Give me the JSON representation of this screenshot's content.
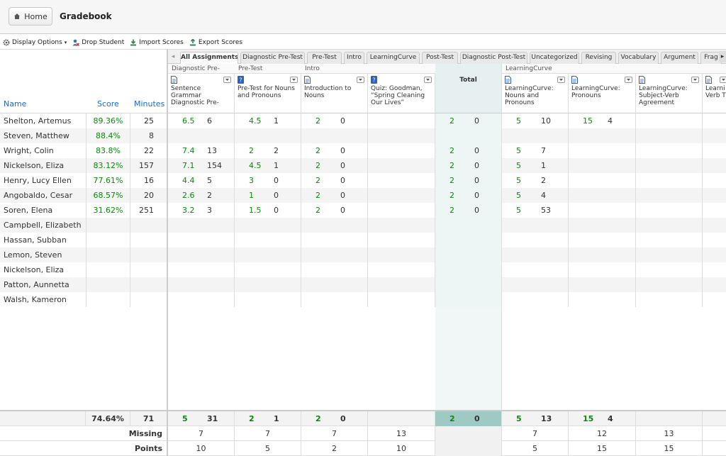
{
  "topbar": {
    "home_label": "Home",
    "title": "Gradebook"
  },
  "toolbar": {
    "display_options": "Display Options",
    "drop_student": "Drop Student",
    "import_scores": "Import Scores",
    "export_scores": "Export Scores"
  },
  "columns": {
    "name": "Name",
    "score": "Score",
    "minutes": "Minutes"
  },
  "tabs": [
    "All Assignments",
    "Diagnostic Pre-Test",
    "Pre-Test",
    "Intro",
    "LearningCurve",
    "Post-Test",
    "Diagnostic Post-Test",
    "Uncategorized",
    "Revising",
    "Vocabulary",
    "Argument",
    "Frag"
  ],
  "groups": [
    "Diagnostic Pre-",
    "Pre-Test",
    "Intro",
    "LearningCurve"
  ],
  "assignments": [
    {
      "title": "Sentence Grammar Diagnostic Pre-",
      "icon": "doc"
    },
    {
      "title": "Pre-Test for Nouns and Pronouns",
      "icon": "quiz"
    },
    {
      "title": "Introduction to Nouns",
      "icon": "doc"
    },
    {
      "title": "Quiz: Goodman, “Spring Cleaning Our Lives”",
      "icon": "quiz"
    },
    {
      "title": "Total",
      "icon": ""
    },
    {
      "title": "LearningCurve: Nouns and Pronouns",
      "icon": "doc"
    },
    {
      "title": "LearningCurve: Pronouns",
      "icon": "doc"
    },
    {
      "title": "LearningCurve: Subject-Verb Agreement",
      "icon": "doc"
    },
    {
      "title": "Learni Verb T",
      "icon": "doc"
    }
  ],
  "students": [
    {
      "name": "Shelton, Artemus",
      "score": "89.36%",
      "minutes": "25",
      "cells": [
        [
          "6.5",
          "6"
        ],
        [
          "4.5",
          "1"
        ],
        [
          "2",
          "0"
        ],
        [
          "",
          ""
        ],
        [
          "2",
          "0"
        ],
        [
          "5",
          "10"
        ],
        [
          "15",
          "4"
        ],
        [
          "",
          ""
        ]
      ]
    },
    {
      "name": "Steven, Matthew",
      "score": "88.4%",
      "minutes": "8",
      "cells": [
        [
          "",
          ""
        ],
        [
          "",
          ""
        ],
        [
          "",
          ""
        ],
        [
          "",
          ""
        ],
        [
          "",
          ""
        ],
        [
          "",
          ""
        ],
        [
          "",
          ""
        ],
        [
          "",
          ""
        ]
      ]
    },
    {
      "name": "Wright, Colin",
      "score": "83.8%",
      "minutes": "22",
      "cells": [
        [
          "7.4",
          "13"
        ],
        [
          "2",
          "2"
        ],
        [
          "2",
          "0"
        ],
        [
          "",
          ""
        ],
        [
          "2",
          "0"
        ],
        [
          "5",
          "7"
        ],
        [
          "",
          ""
        ],
        [
          "",
          ""
        ]
      ]
    },
    {
      "name": "Nickelson, Eliza",
      "score": "83.12%",
      "minutes": "157",
      "cells": [
        [
          "7.1",
          "154"
        ],
        [
          "4.5",
          "1"
        ],
        [
          "2",
          "0"
        ],
        [
          "",
          ""
        ],
        [
          "2",
          "0"
        ],
        [
          "5",
          "1"
        ],
        [
          "",
          ""
        ],
        [
          "",
          ""
        ]
      ]
    },
    {
      "name": "Henry, Lucy Ellen",
      "score": "77.61%",
      "minutes": "16",
      "cells": [
        [
          "4.4",
          "5"
        ],
        [
          "3",
          "0"
        ],
        [
          "2",
          "0"
        ],
        [
          "",
          ""
        ],
        [
          "2",
          "0"
        ],
        [
          "5",
          "2"
        ],
        [
          "",
          ""
        ],
        [
          "",
          ""
        ]
      ]
    },
    {
      "name": "Angobaldo, Cesar",
      "score": "68.57%",
      "minutes": "20",
      "cells": [
        [
          "2.6",
          "2"
        ],
        [
          "1",
          "0"
        ],
        [
          "2",
          "0"
        ],
        [
          "",
          ""
        ],
        [
          "2",
          "0"
        ],
        [
          "5",
          "4"
        ],
        [
          "",
          ""
        ],
        [
          "",
          ""
        ]
      ]
    },
    {
      "name": "Soren, Elena",
      "score": "31.62%",
      "minutes": "251",
      "cells": [
        [
          "3.2",
          "3"
        ],
        [
          "1.5",
          "0"
        ],
        [
          "2",
          "0"
        ],
        [
          "",
          ""
        ],
        [
          "2",
          "0"
        ],
        [
          "5",
          "53"
        ],
        [
          "",
          ""
        ],
        [
          "",
          ""
        ]
      ]
    },
    {
      "name": "Campbell, Elizabeth",
      "score": "",
      "minutes": "",
      "cells": []
    },
    {
      "name": "Hassan, Subban",
      "score": "",
      "minutes": "",
      "cells": []
    },
    {
      "name": "Lemon, Steven",
      "score": "",
      "minutes": "",
      "cells": []
    },
    {
      "name": "Nickelson, Eliza",
      "score": "",
      "minutes": "",
      "cells": []
    },
    {
      "name": "Patton, Aunnetta",
      "score": "",
      "minutes": "",
      "cells": []
    },
    {
      "name": "Walsh, Kameron",
      "score": "",
      "minutes": "",
      "cells": []
    }
  ],
  "summary": {
    "avg_score": "74.64%",
    "avg_minutes": "71",
    "cells": [
      [
        "5",
        "31"
      ],
      [
        "2",
        "1"
      ],
      [
        "2",
        "0"
      ],
      [
        "",
        ""
      ],
      [
        "2",
        "0"
      ],
      [
        "5",
        "13"
      ],
      [
        "15",
        "4"
      ],
      [
        "",
        ""
      ]
    ],
    "missing_label": "Missing",
    "missing": [
      "7",
      "7",
      "7",
      "13",
      "",
      "7",
      "12",
      "13"
    ],
    "points_label": "Points",
    "points": [
      "10",
      "5",
      "2",
      "10",
      "",
      "5",
      "15",
      "15"
    ]
  },
  "colors": {
    "score_green": "#0a8a0a",
    "link_blue": "#1a6bcc",
    "total_bg": "#e6f0f0"
  }
}
